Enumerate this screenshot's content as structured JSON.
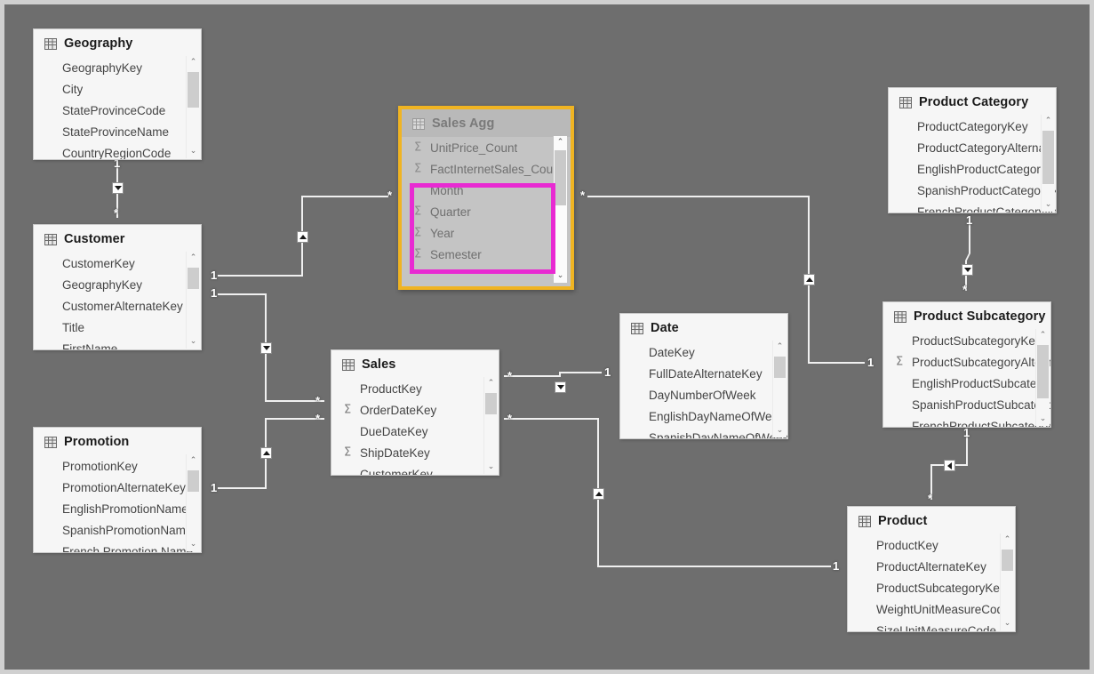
{
  "view": {
    "name": "Power BI model diagram view",
    "canvas_background": "#6e6e6e",
    "highlight_table_border_color": "#f0b422",
    "highlight_fields_border_color": "#e82ad2"
  },
  "icons": {
    "table": "table-grid-icon",
    "measure": "sigma-icon",
    "scroll_up": "chevron-up-icon",
    "scroll_down": "chevron-down-icon"
  },
  "tables": [
    {
      "id": "geography",
      "title": "Geography",
      "fields": [
        {
          "name": "GeographyKey",
          "aggregate": false
        },
        {
          "name": "City",
          "aggregate": false
        },
        {
          "name": "StateProvinceCode",
          "aggregate": false
        },
        {
          "name": "StateProvinceName",
          "aggregate": false
        },
        {
          "name": "CountryRegionCode",
          "aggregate": false
        }
      ]
    },
    {
      "id": "customer",
      "title": "Customer",
      "fields": [
        {
          "name": "CustomerKey",
          "aggregate": false
        },
        {
          "name": "GeographyKey",
          "aggregate": false
        },
        {
          "name": "CustomerAlternateKey",
          "aggregate": false
        },
        {
          "name": "Title",
          "aggregate": false
        },
        {
          "name": "FirstName",
          "aggregate": false
        }
      ]
    },
    {
      "id": "promotion",
      "title": "Promotion",
      "fields": [
        {
          "name": "PromotionKey",
          "aggregate": false
        },
        {
          "name": "PromotionAlternateKey",
          "aggregate": false
        },
        {
          "name": "EnglishPromotionName",
          "aggregate": false
        },
        {
          "name": "SpanishPromotionName",
          "aggregate": false
        },
        {
          "name": "French Promotion Name",
          "aggregate": false
        }
      ]
    },
    {
      "id": "salesagg",
      "title": "Sales Agg",
      "dimmed": true,
      "fields": [
        {
          "name": "UnitPrice_Count",
          "aggregate": true
        },
        {
          "name": "FactInternetSales_Count",
          "aggregate": true
        },
        {
          "name": "Month",
          "aggregate": false
        },
        {
          "name": "Quarter",
          "aggregate": true
        },
        {
          "name": "Year",
          "aggregate": true
        },
        {
          "name": "Semester",
          "aggregate": true
        }
      ]
    },
    {
      "id": "sales",
      "title": "Sales",
      "fields": [
        {
          "name": "ProductKey",
          "aggregate": false
        },
        {
          "name": "OrderDateKey",
          "aggregate": true
        },
        {
          "name": "DueDateKey",
          "aggregate": false
        },
        {
          "name": "ShipDateKey",
          "aggregate": true
        },
        {
          "name": "CustomerKey",
          "aggregate": false
        }
      ]
    },
    {
      "id": "date",
      "title": "Date",
      "fields": [
        {
          "name": "DateKey",
          "aggregate": false
        },
        {
          "name": "FullDateAlternateKey",
          "aggregate": false
        },
        {
          "name": "DayNumberOfWeek",
          "aggregate": false
        },
        {
          "name": "EnglishDayNameOfWeek",
          "aggregate": false
        },
        {
          "name": "SpanishDayNameOfWeek",
          "aggregate": false
        }
      ]
    },
    {
      "id": "productcategory",
      "title": "Product Category",
      "fields": [
        {
          "name": "ProductCategoryKey",
          "aggregate": false
        },
        {
          "name": "ProductCategoryAlternateKey",
          "aggregate": false
        },
        {
          "name": "EnglishProductCategoryName",
          "aggregate": false
        },
        {
          "name": "SpanishProductCategoryName",
          "aggregate": false
        },
        {
          "name": "FrenchProductCategoryName",
          "aggregate": false
        }
      ]
    },
    {
      "id": "productsubcategory",
      "title": "Product Subcategory",
      "fields": [
        {
          "name": "ProductSubcategoryKey",
          "aggregate": false
        },
        {
          "name": "ProductSubcategoryAlternateKey",
          "aggregate": true
        },
        {
          "name": "EnglishProductSubcategoryName",
          "aggregate": false
        },
        {
          "name": "SpanishProductSubcategoryName",
          "aggregate": false
        },
        {
          "name": "FrenchProductSubcategoryName",
          "aggregate": false
        }
      ]
    },
    {
      "id": "product",
      "title": "Product",
      "fields": [
        {
          "name": "ProductKey",
          "aggregate": false
        },
        {
          "name": "ProductAlternateKey",
          "aggregate": false
        },
        {
          "name": "ProductSubcategoryKey",
          "aggregate": false
        },
        {
          "name": "WeightUnitMeasureCode",
          "aggregate": false
        },
        {
          "name": "SizeUnitMeasureCode",
          "aggregate": false
        }
      ]
    }
  ],
  "highlighted_fields": [
    "Month",
    "Quarter",
    "Year",
    "Semester"
  ],
  "relationships": [
    {
      "id": "geography-customer",
      "one": "Geography",
      "many": "Customer",
      "one_label": "1",
      "many_label": "*"
    },
    {
      "id": "customer-salesagg",
      "one": "Customer",
      "many": "Sales Agg",
      "one_label": "1",
      "many_label": "*"
    },
    {
      "id": "customer-sales",
      "one": "Customer",
      "many": "Sales",
      "one_label": "1",
      "many_label": "*"
    },
    {
      "id": "promotion-sales",
      "one": "Promotion",
      "many": "Sales",
      "one_label": "1",
      "many_label": "*"
    },
    {
      "id": "salesagg-date",
      "one": "Date",
      "many": "Sales Agg",
      "one_label": "1",
      "many_label": "*"
    },
    {
      "id": "sales-date",
      "one": "Date",
      "many": "Sales",
      "one_label": "1",
      "many_label": "*"
    },
    {
      "id": "sales-product",
      "one": "Product",
      "many": "Sales",
      "one_label": "1",
      "many_label": "*"
    },
    {
      "id": "productcategory-productsubcategory",
      "one": "Product Category",
      "many": "Product Subcategory",
      "one_label": "1",
      "many_label": "*"
    },
    {
      "id": "productsubcategory-product",
      "one": "Product Subcategory",
      "many": "Product",
      "one_label": "1",
      "many_label": "*"
    }
  ],
  "markers": {
    "one": "1",
    "many": "*"
  }
}
